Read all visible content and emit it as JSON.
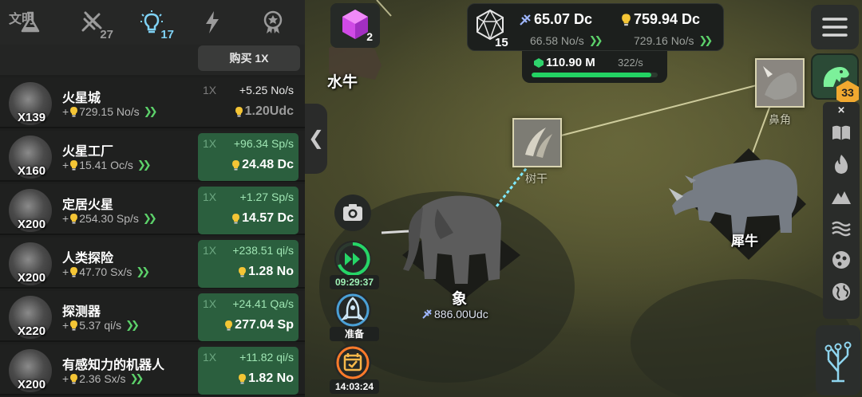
{
  "left_panel": {
    "category_tabs": [
      {
        "icon": "flask-icon",
        "count": ""
      },
      {
        "icon": "dna-icon",
        "count": "27"
      },
      {
        "icon": "lightbulb-icon",
        "count": "17",
        "active": true
      },
      {
        "icon": "lightning-icon",
        "count": ""
      },
      {
        "icon": "medal-icon",
        "count": ""
      }
    ],
    "section_title": "文明",
    "buy_button_label": "购买 1X",
    "rows": [
      {
        "multiplier_count": "X139",
        "name": "火星城",
        "rate_prefix": "+",
        "rate": "729.15 No/s",
        "buy_mult": "1X",
        "gain": "+5.25 No/s",
        "cost": "1.20Udc",
        "affordable": false
      },
      {
        "multiplier_count": "X160",
        "name": "火星工厂",
        "rate_prefix": "+",
        "rate": "15.41 Oc/s",
        "buy_mult": "1X",
        "gain": "+96.34 Sp/s",
        "cost": "24.48 Dc",
        "affordable": true
      },
      {
        "multiplier_count": "X200",
        "name": "定居火星",
        "rate_prefix": "+",
        "rate": "254.30 Sp/s",
        "buy_mult": "1X",
        "gain": "+1.27 Sp/s",
        "cost": "14.57 Dc",
        "affordable": true
      },
      {
        "multiplier_count": "X200",
        "name": "人类探险",
        "rate_prefix": "+",
        "rate": "47.70 Sx/s",
        "buy_mult": "1X",
        "gain": "+238.51 qi/s",
        "cost": "1.28 No",
        "affordable": true
      },
      {
        "multiplier_count": "X220",
        "name": "探测器",
        "rate_prefix": "+",
        "rate": "5.37 qi/s",
        "buy_mult": "1X",
        "gain": "+24.41 Qa/s",
        "cost": "277.04 Sp",
        "affordable": true
      },
      {
        "multiplier_count": "X200",
        "name": "有感知力的机器人",
        "rate_prefix": "+",
        "rate": "2.36 Sx/s",
        "buy_mult": "1X",
        "gain": "+11.82 qi/s",
        "cost": "1.82 No",
        "affordable": true
      }
    ]
  },
  "top_center": {
    "gem_count": "2",
    "d20_count": "15",
    "dna_currency": "65.07 Dc",
    "dna_rate": "66.58 No/s",
    "idea_currency": "759.94 Dc",
    "idea_rate": "729.16 No/s",
    "green_value": "110.90 M",
    "green_rate": "322/s",
    "green_progress": 0.95
  },
  "map": {
    "partial_label": "水牛",
    "elephant_label": "象",
    "elephant_cost": "886.00Udc",
    "rhino_label": "犀牛",
    "tusk_caption": "树干",
    "horn_caption": "鼻角"
  },
  "left_buttons": {
    "timer1": "09:29:37",
    "ready_label": "准备",
    "timer2": "14:03:24"
  },
  "right_side": {
    "badge_count": "33"
  }
}
